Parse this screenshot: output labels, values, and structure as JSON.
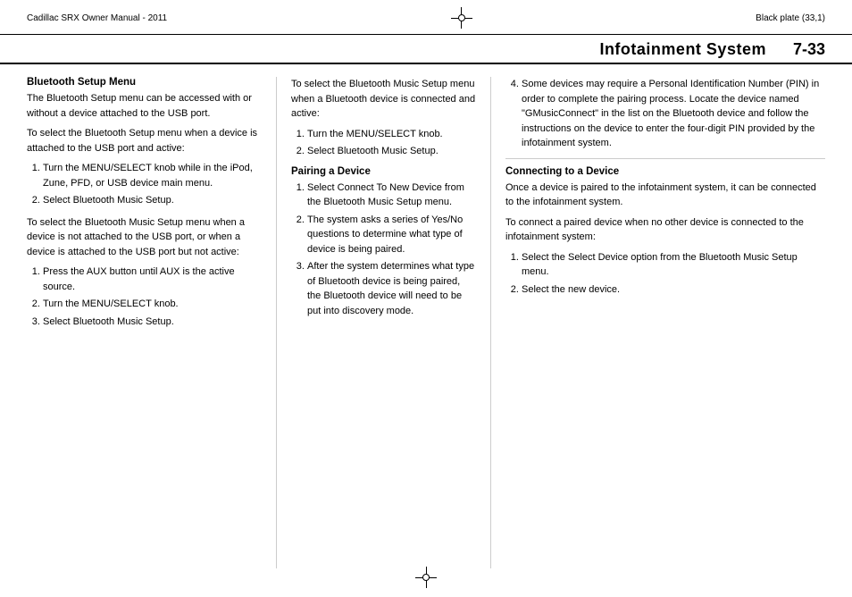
{
  "header": {
    "left": "Cadillac SRX Owner Manual - 2011",
    "right": "Black plate (33,1)"
  },
  "title": {
    "section": "Infotainment System",
    "page": "7-33"
  },
  "left_col": {
    "heading": "Bluetooth Setup Menu",
    "para1": "The Bluetooth Setup menu can be accessed with or without a device attached to the USB port.",
    "para2": "To select the Bluetooth Setup menu when a device is attached to the USB port and active:",
    "list1": [
      "Turn the MENU/SELECT knob while in the iPod, Zune, PFD, or USB device main menu.",
      "Select Bluetooth Music Setup."
    ],
    "para3": "To select the Bluetooth Music Setup menu when a device is not attached to the USB port, or when a device is attached to the USB port but not active:",
    "list2": [
      "Press the AUX button until AUX is the active source.",
      "Turn the MENU/SELECT knob.",
      "Select Bluetooth Music Setup."
    ]
  },
  "middle_col": {
    "para1": "To select the Bluetooth Music Setup menu when a Bluetooth device is connected and active:",
    "list1": [
      "Turn the MENU/SELECT knob.",
      "Select Bluetooth Music Setup."
    ],
    "heading2": "Pairing a Device",
    "list2": [
      "Select Connect To New Device from the Bluetooth Music Setup menu.",
      "The system asks a series of Yes/No questions to determine what type of device is being paired.",
      "After the system determines what type of Bluetooth device is being paired, the Bluetooth device will need to be put into discovery mode."
    ]
  },
  "right_col": {
    "list1": [
      "Some devices may require a Personal Identification Number (PIN) in order to complete the pairing process. Locate the device named \"GMusicConnect\" in the list on the Bluetooth device and follow the instructions on the device to enter the four-digit PIN provided by the infotainment system."
    ],
    "heading2": "Connecting to a Device",
    "para1": "Once a device is paired to the infotainment system, it can be connected to the infotainment system.",
    "para2": "To connect a paired device when no other device is connected to the infotainment system:",
    "list2": [
      "Select the Select Device option from the Bluetooth Music Setup menu.",
      "Select the new device."
    ]
  }
}
